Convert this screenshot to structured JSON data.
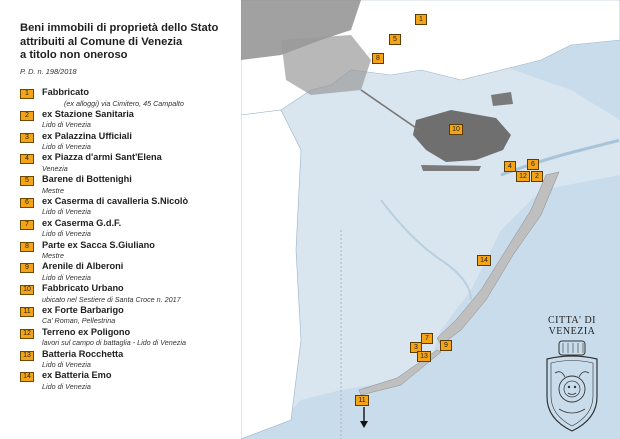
{
  "title": {
    "line1": "Beni immobili di proprietà dello Stato",
    "line2": "attribuiti al Comune di Venezia",
    "line3": "a titolo non oneroso"
  },
  "subtitle": "P. D. n. 198/2018",
  "legend": [
    {
      "num": "1",
      "title": "Fabbricato",
      "sub": "(ex alloggi) via Cimitero, 45 Campalto"
    },
    {
      "num": "2",
      "title": "ex Stazione Sanitaria",
      "sub": "Lido di Venezia"
    },
    {
      "num": "3",
      "title": "ex Palazzina Ufficiali",
      "sub": "Lido di Venezia"
    },
    {
      "num": "4",
      "title": "ex Piazza d'armi Sant'Elena",
      "sub": "Venezia"
    },
    {
      "num": "5",
      "title": "Barene di Bottenighi",
      "sub": "Mestre"
    },
    {
      "num": "6",
      "title": "ex Caserma di cavalleria S.Nicolò",
      "sub": "Lido di Venezia"
    },
    {
      "num": "7",
      "title": "ex Caserma G.d.F.",
      "sub": "Lido di Venezia"
    },
    {
      "num": "8",
      "title": "Parte ex Sacca S.Giuliano",
      "sub": "Mestre"
    },
    {
      "num": "9",
      "title": "Arenile di Alberoni",
      "sub": "Lido di Venezia"
    },
    {
      "num": "10",
      "title": "Fabbricato Urbano",
      "sub": "ubicato nel Sestiere di Santa Croce n. 2017"
    },
    {
      "num": "11",
      "title": "ex Forte Barbarigo",
      "sub": "Ca' Roman, Pellestrina"
    },
    {
      "num": "12",
      "title": "Terreno ex Poligono",
      "sub": "lavori sul campo di battaglia - Lido di Venezia"
    },
    {
      "num": "13",
      "title": "Batteria Rocchetta",
      "sub": "Lido di Venezia"
    },
    {
      "num": "14",
      "title": "ex Batteria Emo",
      "sub": "Lido di Venezia"
    }
  ],
  "map_markers": [
    "1",
    "5",
    "8",
    "10",
    "4",
    "6",
    "12",
    "2",
    "14",
    "7",
    "3",
    "9",
    "13",
    "11"
  ],
  "crest": {
    "line1": "CITTA' DI",
    "line2": "VENEZIA"
  },
  "colors": {
    "marker": "#f5a417",
    "water": "#c9dceb",
    "lagoon": "#d9e6f0",
    "land": "#ffffff",
    "urban": "#8a8a8a"
  }
}
